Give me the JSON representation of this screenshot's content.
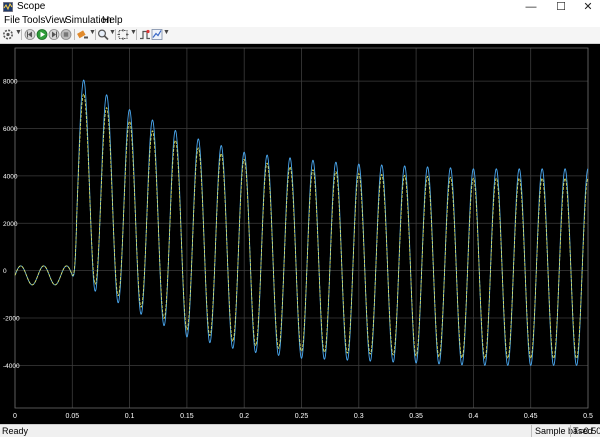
{
  "window": {
    "title": "Scope",
    "controls": {
      "minimize": "—",
      "maximize": "☐",
      "close": "✕"
    }
  },
  "menu": {
    "items": [
      "File",
      "Tools",
      "View",
      "Simulation",
      "Help"
    ]
  },
  "toolbar": {
    "buttons": [
      "settings-icon",
      "step-back-icon",
      "run-icon",
      "step-forward-icon",
      "stop-icon",
      "highlight-icon",
      "zoom-icon",
      "fit-to-view-icon",
      "triggers-icon",
      "cursor-measurements-icon"
    ]
  },
  "status": {
    "state": "Ready",
    "mode": "Sample based",
    "time": "T=0.500"
  },
  "colors": {
    "series_blue": "#4aa8f0",
    "series_yellow": "#e6e65a",
    "grid": "#3c3c3c",
    "tick_label": "#ffffff"
  },
  "chart_data": {
    "type": "line",
    "title": "",
    "xlabel": "",
    "ylabel": "",
    "xlim": [
      0,
      0.5
    ],
    "ylim": [
      -5800,
      9400
    ],
    "xticks": [
      0,
      0.05,
      0.1,
      0.15,
      0.2,
      0.25,
      0.3,
      0.35,
      0.4,
      0.45,
      0.5
    ],
    "xtick_labels": [
      "0",
      "0.05",
      "0.1",
      "0.15",
      "0.2",
      "0.25",
      "0.3",
      "0.35",
      "0.4",
      "0.45",
      "0.5"
    ],
    "yticks": [
      -4000,
      -2000,
      0,
      2000,
      4000,
      6000,
      8000
    ],
    "ytick_labels": [
      "-4000",
      "-2000",
      "0",
      "2000",
      "4000",
      "6000",
      "8000"
    ],
    "grid": true,
    "signal": {
      "frequency_hz": 50,
      "step_time_s": 0.05,
      "pre_step_amplitude": 400,
      "pre_step_offset": -200
    },
    "series": [
      {
        "color": "#4aa8f0",
        "steady_amplitude": 4200,
        "peak_envelope": {
          "t": [
            0.055,
            0.1,
            0.15,
            0.2,
            0.25,
            0.3,
            0.35,
            0.4,
            0.45,
            0.5
          ],
          "values": [
            8200,
            6800,
            5700,
            5000,
            4700,
            4500,
            4400,
            4300,
            4300,
            4300
          ]
        },
        "trough_envelope": {
          "t": [
            0.055,
            0.1,
            0.15,
            0.2,
            0.25,
            0.3,
            0.35,
            0.4,
            0.45,
            0.5
          ],
          "values": [
            -500,
            -1600,
            -2800,
            -3400,
            -3700,
            -3800,
            -3900,
            -4000,
            -4000,
            -4000
          ]
        }
      },
      {
        "color": "#e6e65a",
        "steady_amplitude": 3900,
        "peak_envelope": {
          "t": [
            0.055,
            0.1,
            0.15,
            0.2,
            0.25,
            0.3,
            0.35,
            0.4,
            0.45,
            0.5
          ],
          "values": [
            7600,
            6300,
            5300,
            4700,
            4300,
            4100,
            4000,
            3900,
            3900,
            3900
          ]
        },
        "trough_envelope": {
          "t": [
            0.055,
            0.1,
            0.15,
            0.2,
            0.25,
            0.3,
            0.35,
            0.4,
            0.45,
            0.5
          ],
          "values": [
            -200,
            -1300,
            -2500,
            -3100,
            -3400,
            -3500,
            -3600,
            -3700,
            -3700,
            -3700
          ]
        }
      }
    ]
  }
}
